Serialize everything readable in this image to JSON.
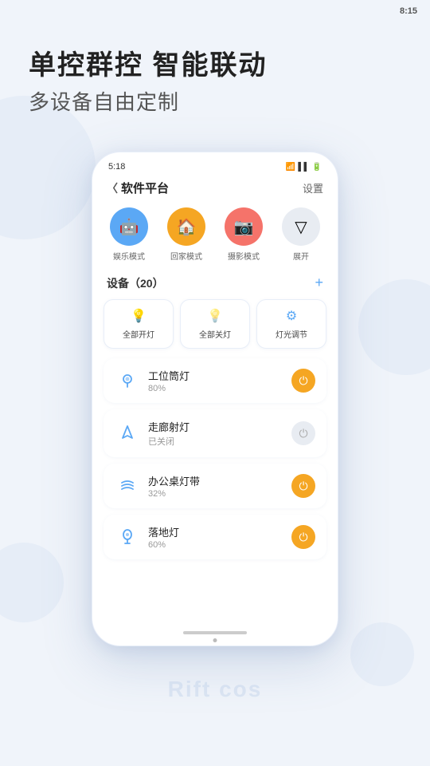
{
  "statusBar": {
    "time": "8:15"
  },
  "hero": {
    "title": "单控群控 智能联动",
    "subtitle": "多设备自由定制"
  },
  "phone": {
    "statusBar": {
      "time": "5:18"
    },
    "header": {
      "back": "〈",
      "title": "软件平台",
      "settings": "设置"
    },
    "modes": [
      {
        "label": "娱乐模式",
        "icon": "🤖",
        "color": "blue"
      },
      {
        "label": "回家模式",
        "icon": "🏠",
        "color": "orange"
      },
      {
        "label": "摄影模式",
        "icon": "📷",
        "color": "red"
      },
      {
        "label": "展开",
        "icon": "▽",
        "color": "gray"
      }
    ],
    "devicesSection": {
      "title": "设备（20）",
      "addIcon": "+"
    },
    "quickActions": [
      {
        "label": "全部开灯",
        "icon": "💡"
      },
      {
        "label": "全部关灯",
        "icon": "💡"
      },
      {
        "label": "灯光调节",
        "icon": "⚙"
      }
    ],
    "devices": [
      {
        "name": "工位筒灯",
        "status": "80%",
        "powerOn": true,
        "iconColor": "#5ba8f5"
      },
      {
        "name": "走廊射灯",
        "status": "已关闭",
        "powerOn": false,
        "iconColor": "#5ba8f5"
      },
      {
        "name": "办公桌灯带",
        "status": "32%",
        "powerOn": true,
        "iconColor": "#5ba8f5"
      },
      {
        "name": "落地灯",
        "status": "60%",
        "powerOn": true,
        "iconColor": "#5ba8f5"
      }
    ]
  },
  "watermark": "Rift cos"
}
